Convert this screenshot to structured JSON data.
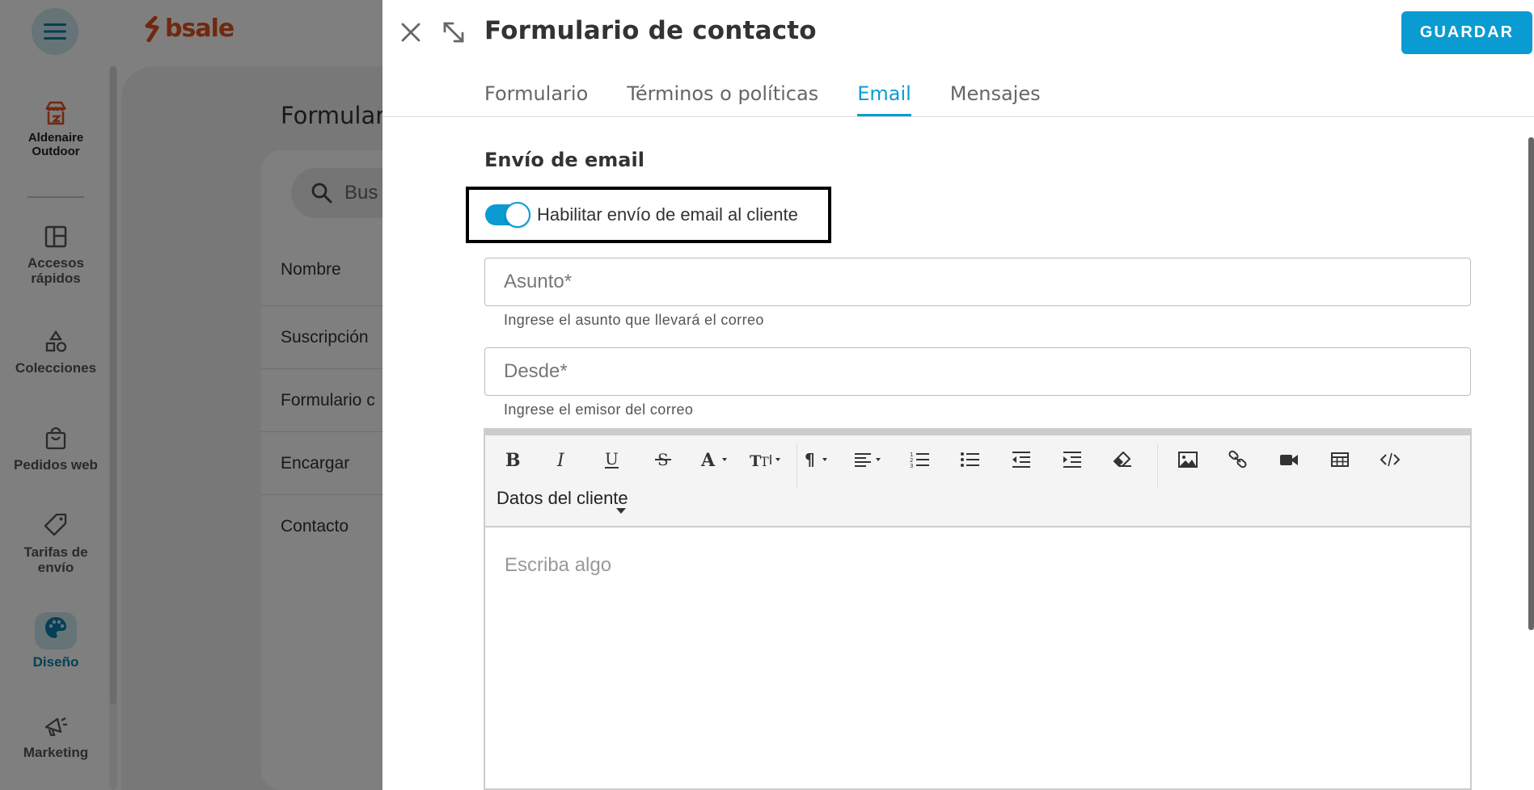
{
  "app": {
    "logo_text": "bsale",
    "store_name": "Aldenaire Outdoor",
    "nav": [
      {
        "label": "Accesos rápidos",
        "icon": "layout-icon"
      },
      {
        "label": "Colecciones",
        "icon": "shapes-icon"
      },
      {
        "label": "Pedidos web",
        "icon": "bag-icon"
      },
      {
        "label": "Tarifas de envío",
        "icon": "tag-icon"
      },
      {
        "label": "Diseño",
        "icon": "palette-icon",
        "active": true
      },
      {
        "label": "Marketing",
        "icon": "megaphone-icon"
      }
    ]
  },
  "background_page": {
    "title": "Formular",
    "search_placeholder": "Bus",
    "column_header": "Nombre",
    "rows": [
      "Suscripción",
      "Formulario c",
      "Encargar",
      "Contacto"
    ]
  },
  "drawer": {
    "title": "Formulario de contacto",
    "save_label": "GUARDAR",
    "tabs": [
      {
        "label": "Formulario",
        "active": false
      },
      {
        "label": "Términos o políticas",
        "active": false
      },
      {
        "label": "Email",
        "active": true
      },
      {
        "label": "Mensajes",
        "active": false
      }
    ],
    "section_title": "Envío de email",
    "toggle": {
      "label": "Habilitar envío de email al cliente",
      "checked": true
    },
    "subject": {
      "placeholder": "Asunto*",
      "hint": "Ingrese el asunto que llevará el correo"
    },
    "from": {
      "placeholder": "Desde*",
      "hint": "Ingrese el emisor del correo"
    },
    "editor": {
      "placeholder": "Escriba algo",
      "dropdown_label": "Datos del cliente"
    }
  },
  "colors": {
    "accent": "#0a9bd2",
    "brand": "#e3501f",
    "overlay": "rgba(0,0,0,0.5)"
  }
}
